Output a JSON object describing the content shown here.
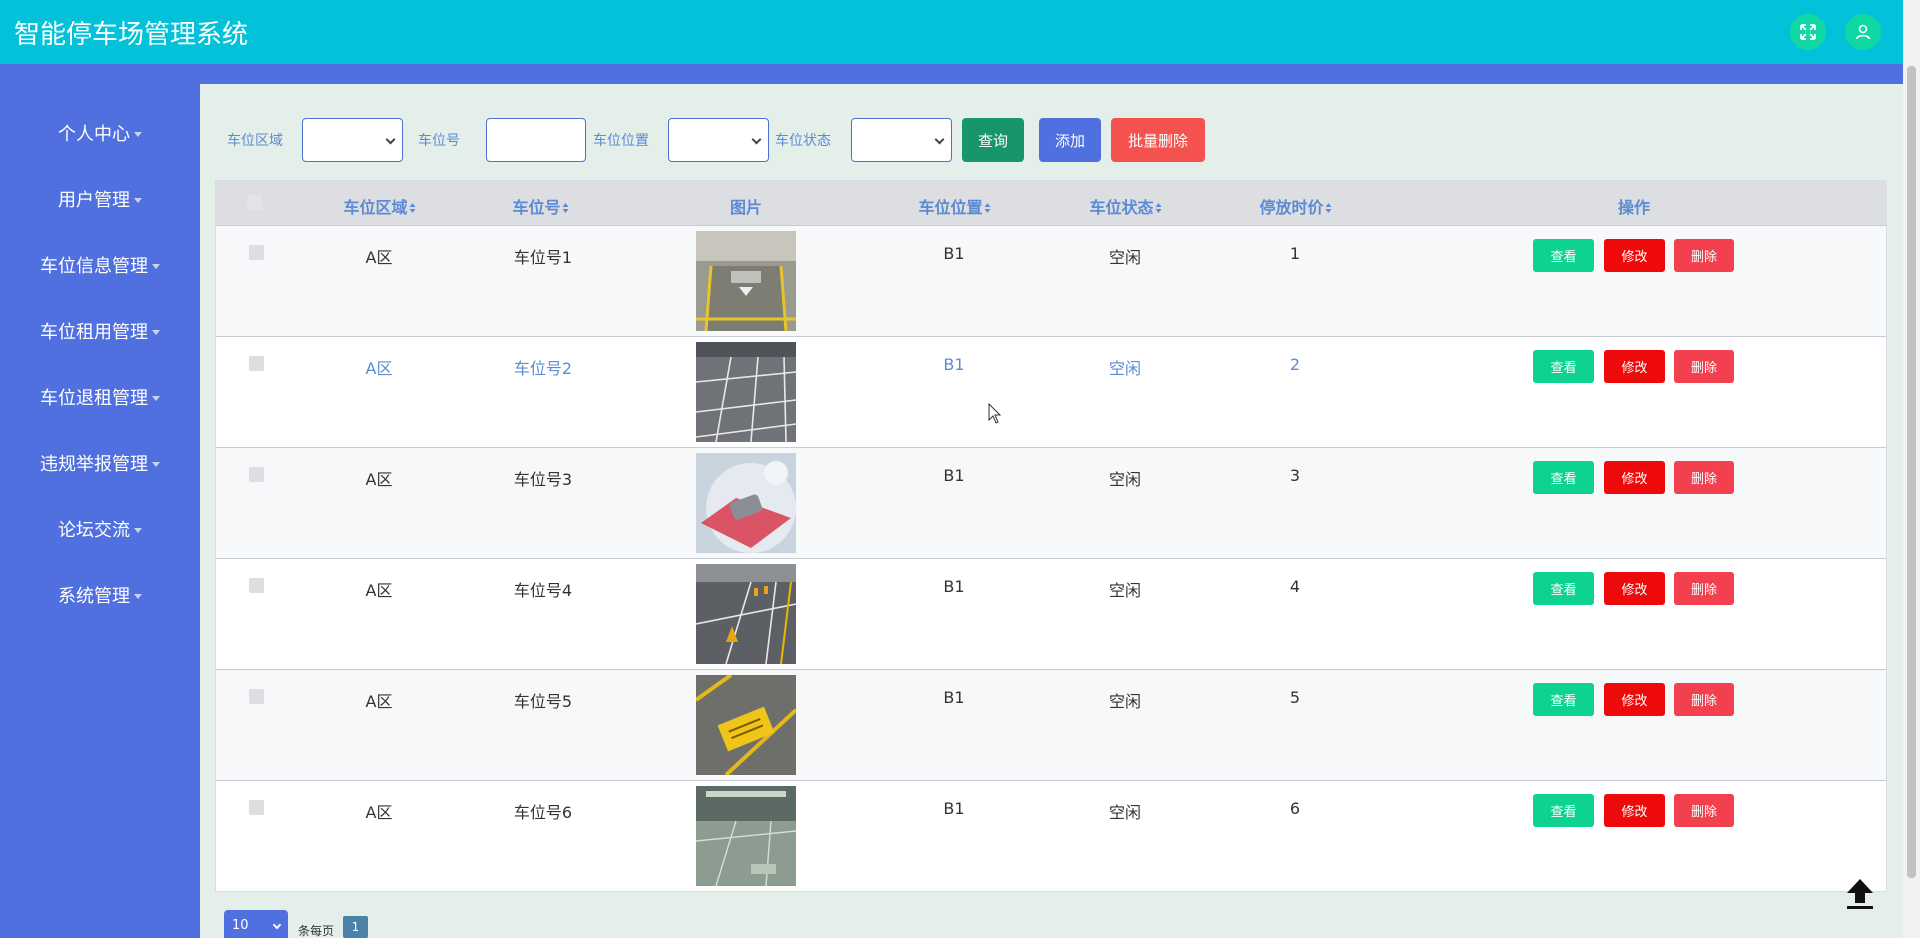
{
  "header": {
    "app_title": "智能停车场管理系统",
    "icons": [
      "fullscreen-icon",
      "user-icon"
    ],
    "bg_color": "#02c1d8"
  },
  "sidebar": {
    "bg_color": "#5070df",
    "items": [
      {
        "label": "个人中心"
      },
      {
        "label": "用户管理"
      },
      {
        "label": "车位信息管理"
      },
      {
        "label": "车位租用管理"
      },
      {
        "label": "车位退租管理"
      },
      {
        "label": "违规举报管理"
      },
      {
        "label": "论坛交流"
      },
      {
        "label": "系统管理"
      }
    ]
  },
  "filters": {
    "area_label": "车位区域",
    "area_value": "",
    "number_label": "车位号",
    "number_value": "",
    "location_label": "车位位置",
    "location_value": "",
    "status_label": "车位状态",
    "status_value": "",
    "query_button": "查询",
    "add_button": "添加",
    "batch_delete_button": "批量删除"
  },
  "table": {
    "headers": {
      "area": "车位区域",
      "number": "车位号",
      "image": "图片",
      "location": "车位位置",
      "status": "车位状态",
      "price": "停放时价",
      "actions": "操作"
    },
    "rows": [
      {
        "area": "A区",
        "number": "车位号1",
        "location": "B1",
        "status": "空闲",
        "price": "1"
      },
      {
        "area": "A区",
        "number": "车位号2",
        "location": "B1",
        "status": "空闲",
        "price": "2"
      },
      {
        "area": "A区",
        "number": "车位号3",
        "location": "B1",
        "status": "空闲",
        "price": "3"
      },
      {
        "area": "A区",
        "number": "车位号4",
        "location": "B1",
        "status": "空闲",
        "price": "4"
      },
      {
        "area": "A区",
        "number": "车位号5",
        "location": "B1",
        "status": "空闲",
        "price": "5"
      },
      {
        "area": "A区",
        "number": "车位号6",
        "location": "B1",
        "status": "空闲",
        "price": "6"
      }
    ],
    "action_labels": {
      "view": "查看",
      "edit": "修改",
      "delete": "删除"
    }
  },
  "pagination": {
    "page_size": "10",
    "per_page_text": "条每页",
    "current_page": "1"
  },
  "colors": {
    "accent": "#5070df",
    "view": "#0dd38f",
    "edit": "#ee0a0a",
    "delete": "#f2404e",
    "query": "#17956b",
    "batch_delete": "#f4524e"
  }
}
